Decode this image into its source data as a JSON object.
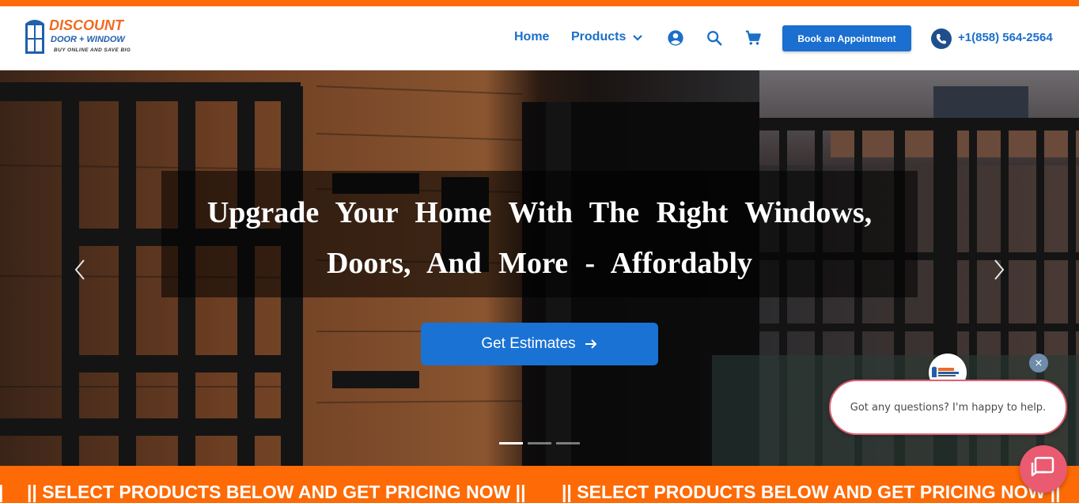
{
  "brand": {
    "line1": "DISCOUNT",
    "line2": "DOOR + WINDOW",
    "tagline": "BUY ONLINE AND SAVE BIG",
    "colors": {
      "orange": "#fe6a05",
      "blue": "#1a6fc9"
    }
  },
  "nav": {
    "home": "Home",
    "products": "Products",
    "icons": [
      "account-icon",
      "search-icon",
      "cart-icon"
    ],
    "book_button": "Book an Appointment",
    "phone": "+1(858) 564-2564"
  },
  "hero": {
    "title": "Upgrade Your Home With The Right Windows, Doors, And More - Affordably",
    "cta": "Get Estimates",
    "slide_count": 3,
    "active_slide": 1
  },
  "ticker": {
    "text": "|| SELECT PRODUCTS BELOW AND GET PRICING NOW ||",
    "lead": "|"
  },
  "chat": {
    "message": "Got any questions? I'm happy to help.",
    "close": "×"
  }
}
